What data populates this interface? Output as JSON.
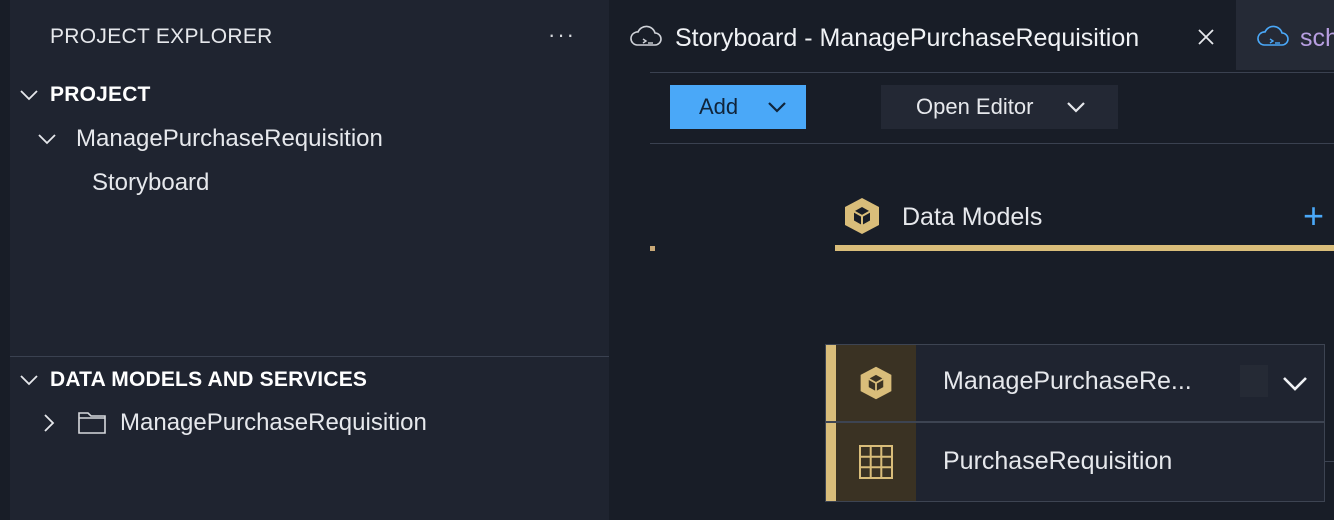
{
  "sidebar": {
    "explorer_title": "PROJECT EXPLORER",
    "more_icon": "ellipsis-icon",
    "project_section": {
      "title": "PROJECT",
      "items": [
        {
          "label": "ManagePurchaseRequisition",
          "expanded": true
        },
        {
          "label": "Storyboard"
        }
      ]
    },
    "data_section": {
      "title": "DATA MODELS AND SERVICES",
      "items": [
        {
          "label": "ManagePurchaseRequisition",
          "icon": "folder-icon",
          "expanded": false
        }
      ]
    }
  },
  "tabs": [
    {
      "label": "Storyboard - ManagePurchaseRequisition",
      "icon": "cloud-icon",
      "active": true
    },
    {
      "label": "sch",
      "icon": "cloud-icon",
      "active": false
    }
  ],
  "toolbar": {
    "add_label": "Add",
    "open_editor_label": "Open Editor"
  },
  "canvas": {
    "section_title": "Data Models",
    "cards": [
      {
        "label": "ManagePurchaseRe...",
        "icon": "cube-icon"
      },
      {
        "label": "PurchaseRequisition",
        "icon": "table-grid-icon"
      }
    ]
  },
  "colors": {
    "accent_blue": "#4aa8f8",
    "gold": "#d9bd7a",
    "background": "#181d27",
    "panel": "#1f2430"
  }
}
